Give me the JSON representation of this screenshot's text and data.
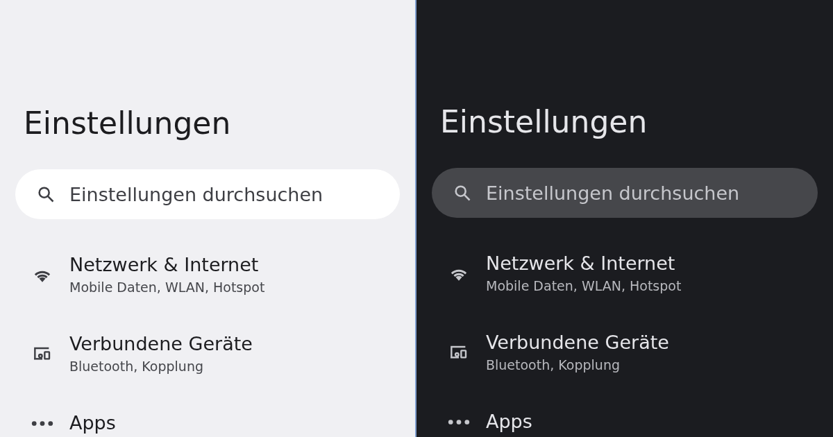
{
  "panels": [
    {
      "kind": "light",
      "title": "Einstellungen",
      "search": {
        "placeholder": "Einstellungen durchsuchen"
      },
      "items": [
        {
          "kind": "wifi",
          "title": "Netzwerk & Internet",
          "subtitle": "Mobile Daten, WLAN, Hotspot"
        },
        {
          "kind": "devices",
          "title": "Verbundene Geräte",
          "subtitle": "Bluetooth, Kopplung"
        },
        {
          "kind": "apps",
          "title": "Apps"
        }
      ]
    },
    {
      "kind": "dark",
      "title": "Einstellungen",
      "search": {
        "placeholder": "Einstellungen durchsuchen"
      },
      "items": [
        {
          "kind": "wifi",
          "title": "Netzwerk & Internet",
          "subtitle": "Mobile Daten, WLAN, Hotspot"
        },
        {
          "kind": "devices",
          "title": "Verbundene Geräte",
          "subtitle": "Bluetooth, Kopplung"
        },
        {
          "kind": "apps",
          "title": "Apps"
        }
      ]
    }
  ]
}
